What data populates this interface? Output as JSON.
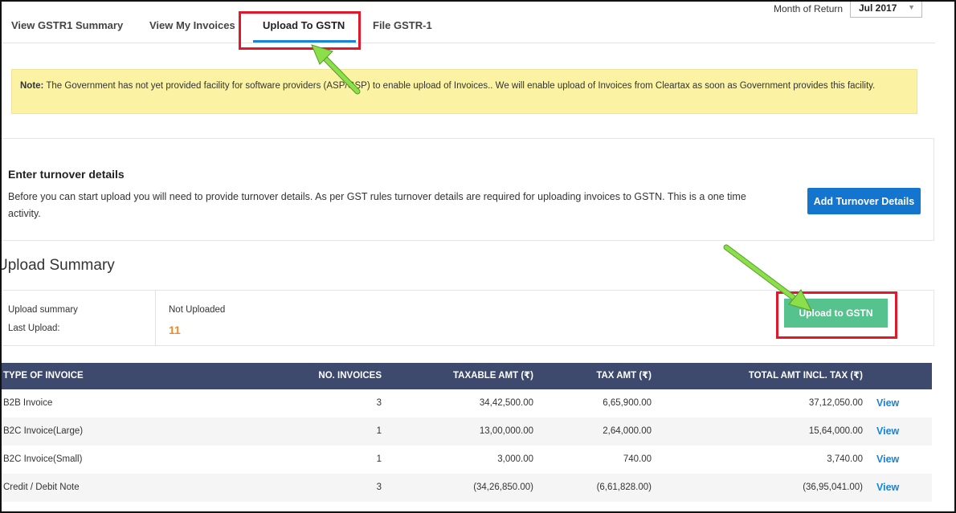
{
  "tabs": [
    {
      "label": "View GSTR1 Summary"
    },
    {
      "label": "View My Invoices"
    },
    {
      "label": "Upload To GSTN"
    },
    {
      "label": "File GSTR-1"
    }
  ],
  "month_of_return": {
    "label": "Month of Return",
    "value": "Jul 2017"
  },
  "note": {
    "prefix": "Note:",
    "text": " The Government has not yet provided facility for software providers (ASP/GSP) to enable upload of Invoices.. We will enable upload of Invoices from Cleartax as soon as Government provides this facility."
  },
  "turnover": {
    "title": "Enter turnover details",
    "description": "Before you can start upload you will need to provide turnover details. As per GST rules turnover details are required for uploading invoices to GSTN. This is a one time activity.",
    "button": "Add Turnover Details"
  },
  "upload_summary": {
    "heading": "Upload Summary",
    "label_summary": "Upload summary",
    "label_last": "Last Upload:",
    "status": "Not Uploaded",
    "count": "11",
    "button": "Upload to GSTN"
  },
  "table": {
    "headers": {
      "type": "TYPE OF INVOICE",
      "num": "NO. INVOICES",
      "taxable": "TAXABLE AMT (₹)",
      "tax": "TAX AMT (₹)",
      "total": "TOTAL AMT INCL. TAX (₹)"
    },
    "rows": [
      {
        "type": "B2B Invoice",
        "num": "3",
        "taxable": "34,42,500.00",
        "tax": "6,65,900.00",
        "total": "37,12,050.00",
        "action": "View"
      },
      {
        "type": "B2C Invoice(Large)",
        "num": "1",
        "taxable": "13,00,000.00",
        "tax": "2,64,000.00",
        "total": "15,64,000.00",
        "action": "View"
      },
      {
        "type": "B2C Invoice(Small)",
        "num": "1",
        "taxable": "3,000.00",
        "tax": "740.00",
        "total": "3,740.00",
        "action": "View"
      },
      {
        "type": "Credit / Debit Note",
        "num": "3",
        "taxable": "(34,26,850.00)",
        "tax": "(6,61,828.00)",
        "total": "(36,95,041.00)",
        "action": "View"
      }
    ]
  },
  "colors": {
    "active_tab_underline": "#1b83d6",
    "highlight_box": "#e0192a",
    "annotation_arrow": "#8be04a",
    "note_background": "#fbf3a3",
    "primary_button": "#1475cf",
    "upload_button": "#56c28e",
    "table_header": "#3d4a6e",
    "count_text": "#f08a24"
  }
}
